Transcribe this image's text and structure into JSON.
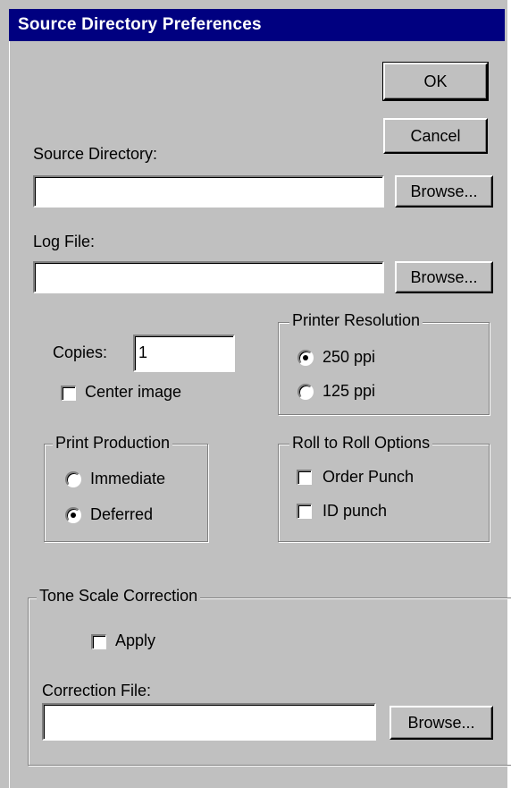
{
  "window": {
    "title": "Source Directory Preferences"
  },
  "buttons": {
    "ok": "OK",
    "cancel": "Cancel",
    "browse": "Browse..."
  },
  "source_directory": {
    "label": "Source Directory:",
    "value": ""
  },
  "log_file": {
    "label": "Log File:",
    "value": ""
  },
  "copies": {
    "label": "Copies:",
    "value": "1"
  },
  "center_image": {
    "label": "Center image",
    "checked": false
  },
  "printer_resolution": {
    "title": "Printer Resolution",
    "options": [
      {
        "label": "250 ppi",
        "selected": true
      },
      {
        "label": "125 ppi",
        "selected": false
      }
    ]
  },
  "print_production": {
    "title": "Print Production",
    "options": [
      {
        "label": "Immediate",
        "selected": false
      },
      {
        "label": "Deferred",
        "selected": true
      }
    ]
  },
  "roll_options": {
    "title": "Roll to Roll Options",
    "options": [
      {
        "label": "Order Punch",
        "checked": false
      },
      {
        "label": "ID punch",
        "checked": false
      }
    ]
  },
  "tone_scale": {
    "title": "Tone Scale Correction",
    "apply_label": "Apply",
    "apply_checked": false,
    "file_label": "Correction File:",
    "file_value": ""
  }
}
